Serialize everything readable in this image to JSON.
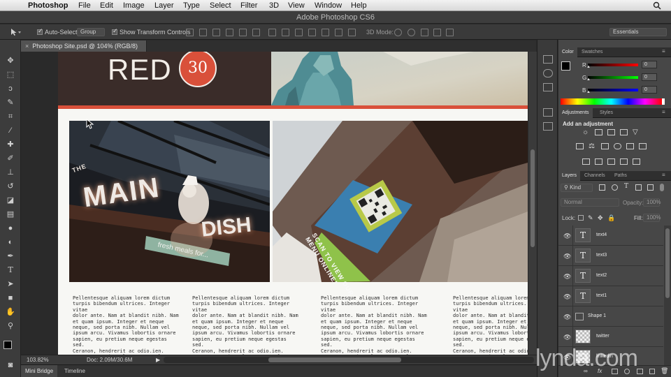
{
  "menubar": {
    "app_name": "Photoshop",
    "items": [
      "File",
      "Edit",
      "Image",
      "Layer",
      "Type",
      "Select",
      "Filter",
      "3D",
      "View",
      "Window",
      "Help"
    ]
  },
  "window": {
    "title": "Adobe Photoshop CS6"
  },
  "options_bar": {
    "auto_select_label": "Auto-Select:",
    "auto_select_value": "Group",
    "show_transform_label": "Show Transform Controls",
    "mode_3d_label": "3D Mode:",
    "workspace": "Essentials"
  },
  "document": {
    "tab_title": "Photoshop Site.psd @ 104% (RGB/8)",
    "logo_text": "RED",
    "logo_badge": "30",
    "restaurant_sign": {
      "the": "THE",
      "main": "MAIN",
      "dish": "DISH",
      "tagline": "fresh meals for..."
    },
    "menu_overlay": "SCAN TO VIEW OUR\nMENU ONLINE!",
    "body_columns": [
      "Pellentesque aliquam lorem dictum\nturpis bibendum ultrices. Integer vitae\ndolor ante. Nam at blandit nibh. Nam\net quam ipsum. Integer et neque\nneque, sed porta nibh. Nullam vel\nipsum arcu. Vivamus lobortis ornare\nsapien, eu pretium neque egestas sed.\nCeranon, hendrerit ac odio.ien.\nPraesent varius, lacus orta placerat\npurus urna nec urna.",
      "Pellentesque aliquam lorem dictum\nturpis bibendum ultrices. Integer vitae\ndolor ante. Nam at blandit nibh. Nam\net quam ipsum. Integer et neque\nneque, sed porta nibh. Nullam vel\nipsum arcu. Vivamus lobortis ornare\nsapien, eu pretium neque egestas sed.\nCeranon, hendrerit ac odio.ien.\nPraesent varius, lacus orta placerat\npurus urna nec urna.",
      "Pellentesque aliquam lorem dictum\nturpis bibendum ultrices. Integer vitae\ndolor ante. Nam at blandit nibh. Nam\net quam ipsum. Integer et neque\nneque, sed porta nibh. Nullam vel\nipsum arcu. Vivamus lobortis ornare\nsapien, eu pretium neque egestas sed.\nCeranon, hendrerit ac odio.ien.\nPraesent varius, lacus orta placerat\npurus urna nec urna.",
      "Pellentesque aliquam lorem dictum\nturpis bibendum ultrices. Integer vitae\ndolor ante. Nam at blandit nibh. Nam\net quam ipsum. Integer et neque\nneque, sed porta nibh. Nullam vel\nipsum arcu. Vivamus lobortis ornare\nsapien, eu pretium neque egestas sed.\nCeranon, hendrerit ac odio.ien.\nPraesent varius, lacus orta placerat\npurus urna nec urna."
    ]
  },
  "status": {
    "zoom": "103.82%",
    "doc_size": "Doc: 2.09M/30.6M"
  },
  "bottom_tabs": [
    "Mini Bridge",
    "Timeline"
  ],
  "color_panel": {
    "tabs": [
      "Color",
      "Swatches"
    ],
    "channels": [
      {
        "label": "R",
        "value": "0"
      },
      {
        "label": "G",
        "value": "0"
      },
      {
        "label": "B",
        "value": "0"
      }
    ]
  },
  "adjustments_panel": {
    "tabs": [
      "Adjustments",
      "Styles"
    ],
    "heading": "Add an adjustment"
  },
  "layers_panel": {
    "tabs": [
      "Layers",
      "Channels",
      "Paths"
    ],
    "filter": "Kind",
    "blend_mode": "Normal",
    "opacity_label": "Opacity:",
    "opacity_value": "100%",
    "lock_label": "Lock:",
    "fill_label": "Fill:",
    "fill_value": "100%",
    "layers": [
      {
        "name": "text4",
        "kind": "T"
      },
      {
        "name": "text3",
        "kind": "T"
      },
      {
        "name": "text2",
        "kind": "T"
      },
      {
        "name": "text1",
        "kind": "T"
      },
      {
        "name": "Shape 1",
        "kind": "shape"
      },
      {
        "name": "twitter",
        "kind": "image"
      },
      {
        "name": "linkedin",
        "kind": "image"
      }
    ]
  },
  "watermark": "lynda.com",
  "colors": {
    "accent_red": "#d9503a",
    "header_dark": "#3a2c29",
    "menu_green": "#8fc24a",
    "menu_blue": "#2f8fbf"
  }
}
